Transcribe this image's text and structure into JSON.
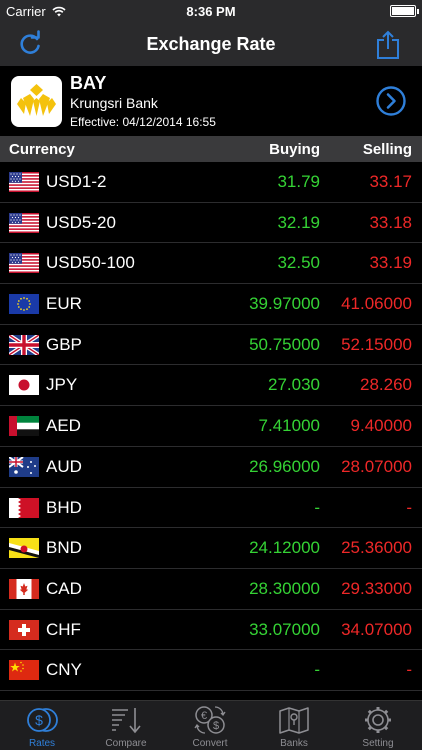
{
  "status_bar": {
    "carrier": "Carrier",
    "time": "8:36 PM"
  },
  "nav": {
    "title": "Exchange Rate",
    "refresh_icon": "refresh-icon",
    "share_icon": "share-icon"
  },
  "bank": {
    "code": "BAY",
    "name": "Krungsri Bank",
    "effective": "Effective: 04/12/2014 16:55",
    "logo_color": "#f4c20d"
  },
  "table": {
    "headers": {
      "currency": "Currency",
      "buying": "Buying",
      "selling": "Selling"
    },
    "rows": [
      {
        "flag": "us",
        "code": "USD1-2",
        "buying": "31.79",
        "selling": "33.17"
      },
      {
        "flag": "us",
        "code": "USD5-20",
        "buying": "32.19",
        "selling": "33.18"
      },
      {
        "flag": "us",
        "code": "USD50-100",
        "buying": "32.50",
        "selling": "33.19"
      },
      {
        "flag": "eu",
        "code": "EUR",
        "buying": "39.97000",
        "selling": "41.06000"
      },
      {
        "flag": "gb",
        "code": "GBP",
        "buying": "50.75000",
        "selling": "52.15000"
      },
      {
        "flag": "jp",
        "code": "JPY",
        "buying": "27.030",
        "selling": "28.260"
      },
      {
        "flag": "ae",
        "code": "AED",
        "buying": "7.41000",
        "selling": "9.40000"
      },
      {
        "flag": "au",
        "code": "AUD",
        "buying": "26.96000",
        "selling": "28.07000"
      },
      {
        "flag": "bh",
        "code": "BHD",
        "buying": "-",
        "selling": "-"
      },
      {
        "flag": "bn",
        "code": "BND",
        "buying": "24.12000",
        "selling": "25.36000"
      },
      {
        "flag": "ca",
        "code": "CAD",
        "buying": "28.30000",
        "selling": "29.33000"
      },
      {
        "flag": "ch",
        "code": "CHF",
        "buying": "33.07000",
        "selling": "34.07000"
      },
      {
        "flag": "cn",
        "code": "CNY",
        "buying": "-",
        "selling": "-"
      }
    ]
  },
  "tabs": [
    {
      "id": "rates",
      "label": "Rates",
      "icon": "coins-icon",
      "active": true
    },
    {
      "id": "compare",
      "label": "Compare",
      "icon": "sort-compare-icon",
      "active": false
    },
    {
      "id": "convert",
      "label": "Convert",
      "icon": "currency-convert-icon",
      "active": false
    },
    {
      "id": "banks",
      "label": "Banks",
      "icon": "map-icon",
      "active": false
    },
    {
      "id": "setting",
      "label": "Setting",
      "icon": "gear-icon",
      "active": false
    }
  ],
  "colors": {
    "accent": "#2f7fd9",
    "buying": "#35d335",
    "selling": "#ee2828",
    "bar": "#2a2a2c"
  }
}
